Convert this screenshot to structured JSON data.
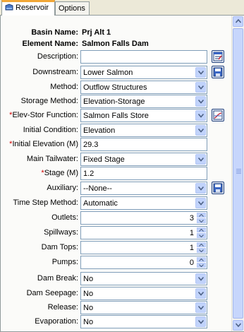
{
  "tabs": [
    {
      "label": "Reservoir",
      "active": true,
      "icon": "reservoir-icon"
    },
    {
      "label": "Options",
      "active": false
    }
  ],
  "header": {
    "basin_label": "Basin Name:",
    "basin_value": "Prj Alt 1",
    "element_label": "Element Name:",
    "element_value": "Salmon Falls Dam"
  },
  "fields": {
    "description": {
      "label": "Description:",
      "value": "",
      "icon": "edit-description-icon"
    },
    "downstream": {
      "label": "Downstream:",
      "value": "Lower Salmon",
      "icon": "save-icon"
    },
    "method": {
      "label": "Method:",
      "value": "Outflow Structures"
    },
    "storage_method": {
      "label": "Storage Method:",
      "value": "Elevation-Storage"
    },
    "elev_stor_function": {
      "label": "Elev-Stor Function:",
      "required": "*",
      "value": "Salmon Falls Store",
      "icon": "graph-icon"
    },
    "initial_condition": {
      "label": "Initial Condition:",
      "value": "Elevation"
    },
    "initial_elevation": {
      "label": "Initial Elevation (M)",
      "required": "*",
      "value": "29.3"
    },
    "main_tailwater": {
      "label": "Main Tailwater:",
      "value": "Fixed Stage"
    },
    "stage": {
      "label": "Stage (M)",
      "required": "*",
      "value": "1.2"
    },
    "auxiliary": {
      "label": "Auxiliary:",
      "value": "--None--",
      "icon": "save-icon"
    },
    "time_step_method": {
      "label": "Time Step Method:",
      "value": "Automatic"
    },
    "outlets": {
      "label": "Outlets:",
      "value": "3"
    },
    "spillways": {
      "label": "Spillways:",
      "value": "1"
    },
    "dam_tops": {
      "label": "Dam Tops:",
      "value": "1"
    },
    "pumps": {
      "label": "Pumps:",
      "value": "0"
    },
    "dam_break": {
      "label": "Dam Break:",
      "value": "No"
    },
    "dam_seepage": {
      "label": "Dam Seepage:",
      "value": "No"
    },
    "release": {
      "label": "Release:",
      "value": "No"
    },
    "evaporation": {
      "label": "Evaporation:",
      "value": "No"
    }
  },
  "colors": {
    "accent_tab": "#f1a737",
    "field_border": "#7f9db9",
    "required": "#d00000",
    "button": "#c1d3fb"
  }
}
